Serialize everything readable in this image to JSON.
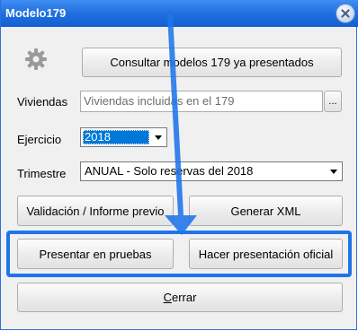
{
  "window": {
    "title": "Modelo179",
    "close_icon": "close-icon"
  },
  "colors": {
    "titlebar": "#1f6fe0",
    "highlight": "#1e75eb",
    "selection": "#0078d7"
  },
  "buttons": {
    "consultar": "Consultar modelos 179 ya presentados",
    "ellipsis": "...",
    "validacion": "Validación / Informe previo",
    "generar_xml": "Generar XML",
    "presentar_pruebas": "Presentar en pruebas",
    "presentacion_oficial": "Hacer presentación oficial",
    "cerrar_underline": "C",
    "cerrar_rest": "errar"
  },
  "form": {
    "viviendas_label": "Viviendas",
    "viviendas_value": "Viviendas incluidas en el 179",
    "ejercicio_label": "Ejercicio",
    "ejercicio_value": "2018",
    "trimestre_label": "Trimestre",
    "trimestre_value": "ANUAL - Solo reservas del 2018"
  },
  "icons": {
    "settings": "gear-icon",
    "dropdown": "chevron-down-icon",
    "annotation": "arrow-down-icon"
  }
}
